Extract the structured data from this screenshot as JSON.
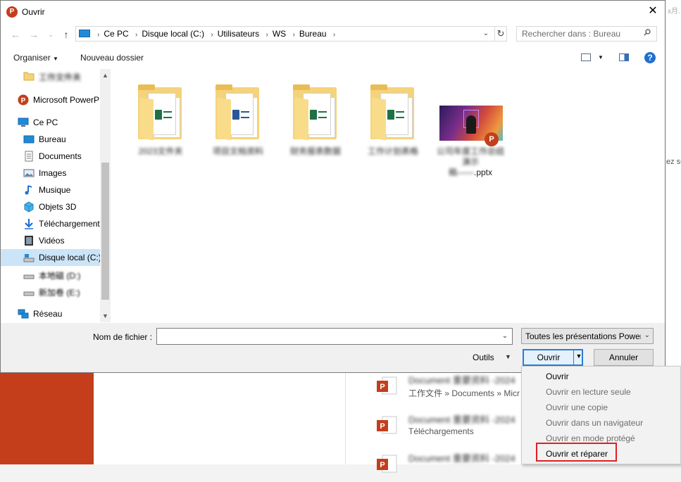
{
  "window": {
    "title": "Ouvrir",
    "app_icon": "powerpoint-icon"
  },
  "background": {
    "side_text": "ez su",
    "corner_text": "x月.",
    "recent_files": [
      {
        "title": "Document 重要资料 -2024",
        "path": "工作文件 » Documents » Micr"
      },
      {
        "title": "Document 重要资料 -2024",
        "path": "Téléchargements"
      },
      {
        "title": "Document 重要资料 -2024",
        "path": ""
      }
    ]
  },
  "navigation": {
    "breadcrumb": [
      "Ce PC",
      "Disque local (C:)",
      "Utilisateurs",
      "WS",
      "Bureau"
    ],
    "search_placeholder": "Rechercher dans : Bureau"
  },
  "toolbar": {
    "organize_label": "Organiser",
    "new_folder_label": "Nouveau dossier"
  },
  "sidebar": {
    "items": [
      {
        "label": "工作文件夹",
        "icon": "folder-icon",
        "blurred": true
      },
      {
        "label": "Microsoft PowerP",
        "icon": "powerpoint-icon"
      },
      {
        "label": "Ce PC",
        "icon": "computer-icon"
      },
      {
        "label": "Bureau",
        "icon": "desktop-icon"
      },
      {
        "label": "Documents",
        "icon": "documents-icon"
      },
      {
        "label": "Images",
        "icon": "images-icon"
      },
      {
        "label": "Musique",
        "icon": "music-icon"
      },
      {
        "label": "Objets 3D",
        "icon": "objects-3d-icon"
      },
      {
        "label": "Téléchargements",
        "icon": "downloads-icon"
      },
      {
        "label": "Vidéos",
        "icon": "videos-icon"
      },
      {
        "label": "Disque local (C:)",
        "icon": "drive-icon"
      },
      {
        "label": "本地磁 (D:)",
        "icon": "drive-icon",
        "blurred": true
      },
      {
        "label": "新加卷 (E:)",
        "icon": "drive-icon",
        "blurred": true
      },
      {
        "label": "Réseau",
        "icon": "network-icon"
      }
    ]
  },
  "files": [
    {
      "name": "2023文件夹",
      "type": "folder",
      "badge": "excel"
    },
    {
      "name": "项目文档资料",
      "type": "folder",
      "badge": "word"
    },
    {
      "name": "财务报表数据",
      "type": "folder",
      "badge": "excel"
    },
    {
      "name": "工作计划表格",
      "type": "folder",
      "badge": "excel"
    },
    {
      "name_line1": "公司年度工作总结演示",
      "name_line2": "稿——",
      "name_suffix": ".pptx",
      "type": "pptx"
    }
  ],
  "bottom": {
    "filename_label": "Nom de fichier :",
    "filename_value": "",
    "filetype_value": "Toutes les présentations PowerPoint",
    "tools_label": "Outils",
    "open_label": "Ouvrir",
    "cancel_label": "Annuler"
  },
  "open_menu": {
    "items": [
      {
        "label": "Ouvrir",
        "enabled": true
      },
      {
        "label": "Ouvrir en lecture seule",
        "enabled": false
      },
      {
        "label": "Ouvrir une copie",
        "enabled": false
      },
      {
        "label": "Ouvrir dans un navigateur",
        "enabled": false
      },
      {
        "label": "Ouvrir en mode protégé",
        "enabled": false
      },
      {
        "label": "Ouvrir et réparer",
        "enabled": true,
        "highlighted": true
      }
    ]
  },
  "colors": {
    "powerpoint": "#c43e1c",
    "selection": "#cce4f7",
    "accent": "#2a7ed7",
    "highlight": "#e02020",
    "excel": "#1e7145",
    "word": "#2b579a"
  }
}
